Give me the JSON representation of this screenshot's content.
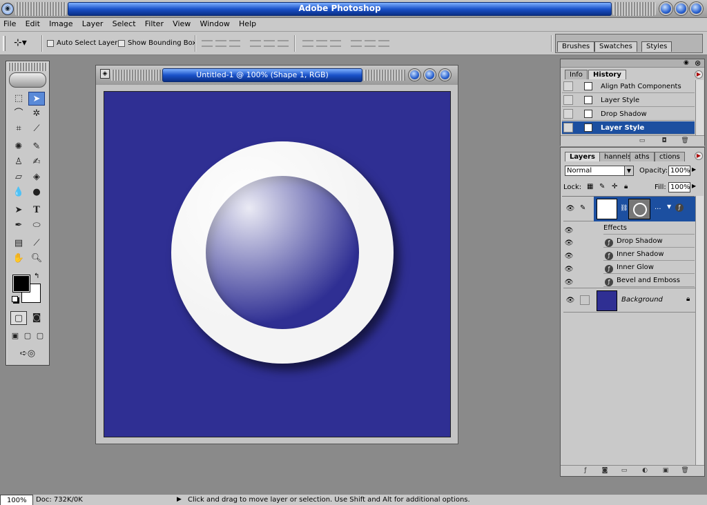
{
  "app": {
    "title": "Adobe Photoshop",
    "icon": "photoshop-eye-icon"
  },
  "menu": [
    "File",
    "Edit",
    "Image",
    "Layer",
    "Select",
    "Filter",
    "View",
    "Window",
    "Help"
  ],
  "options": {
    "auto_select_label": "Auto Select Layer",
    "bounding_box_label": "Show Bounding Box",
    "well_tabs": [
      "Brushes",
      "Swatches",
      "Styles"
    ]
  },
  "document": {
    "title": "Untitled-1 @ 100% (Shape 1, RGB)",
    "canvas_color": "#2f2f93",
    "shape_color": "#f4f4f4"
  },
  "history_panel": {
    "tabs": [
      "Info",
      "History"
    ],
    "items": [
      {
        "label": "Align Path Components"
      },
      {
        "label": "Layer Style"
      },
      {
        "label": "Drop Shadow"
      },
      {
        "label": "Layer Style"
      }
    ]
  },
  "layers_panel": {
    "tabs": [
      "Layers",
      "Channels",
      "Paths",
      "Actions"
    ],
    "tab_display": [
      "Layers",
      "hannels",
      "aths",
      "ctions"
    ],
    "blend_mode": "Normal",
    "opacity_label": "Opacity:",
    "opacity_value": "100%",
    "lock_label": "Lock:",
    "fill_label": "Fill:",
    "fill_value": "100%",
    "effects_label": "Effects",
    "effects": [
      "Drop Shadow",
      "Inner Shadow",
      "Inner Glow",
      "Bevel and Emboss"
    ],
    "background_label": "Background",
    "shape_link_ellipsis": "..."
  },
  "status": {
    "zoom": "100%",
    "doc": "Doc: 732K/0K",
    "message": "Click and drag to move layer or selection.  Use Shift and Alt for additional options."
  }
}
